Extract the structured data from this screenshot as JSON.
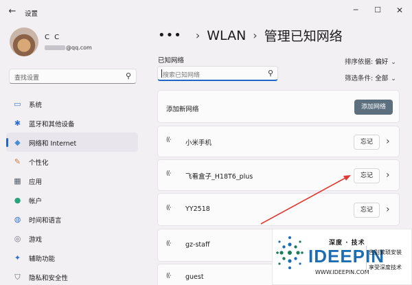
{
  "window": {
    "back_icon": "back-arrow-icon",
    "title": "设置",
    "controls": {
      "minimize": "─",
      "maximize": "☐",
      "close": "✕"
    }
  },
  "user": {
    "name": "C C",
    "email_suffix": "@qq.com"
  },
  "sidebar": {
    "search_placeholder": "查找设置",
    "items": [
      {
        "label": "系统",
        "icon": "monitor-icon",
        "color": "#3a78c9",
        "glyph": "▭"
      },
      {
        "label": "蓝牙和其他设备",
        "icon": "bluetooth-icon",
        "color": "#2f6fca",
        "glyph": "✱"
      },
      {
        "label": "网络和 Internet",
        "icon": "wifi-diamond-icon",
        "color": "#4a8bd6",
        "glyph": "◆",
        "active": true
      },
      {
        "label": "个性化",
        "icon": "brush-icon",
        "color": "#c07a3a",
        "glyph": "✎"
      },
      {
        "label": "应用",
        "icon": "apps-icon",
        "color": "#555d6b",
        "glyph": "▦"
      },
      {
        "label": "帐户",
        "icon": "person-icon",
        "color": "#2aa37a",
        "glyph": "●"
      },
      {
        "label": "时间和语言",
        "icon": "globe-clock-icon",
        "color": "#3578c8",
        "glyph": "◍"
      },
      {
        "label": "游戏",
        "icon": "gamepad-icon",
        "color": "#6b6f78",
        "glyph": "◎"
      },
      {
        "label": "辅助功能",
        "icon": "accessibility-icon",
        "color": "#2f6fca",
        "glyph": "✦"
      },
      {
        "label": "隐私和安全性",
        "icon": "shield-icon",
        "color": "#5a6470",
        "glyph": "⛉"
      }
    ]
  },
  "breadcrumb": {
    "more": "•••",
    "sep": "›",
    "parent": "WLAN",
    "current": "管理已知网络"
  },
  "known_networks": {
    "label": "已知网络",
    "search_placeholder": "搜索已知网络",
    "sort_label": "排序依据:",
    "sort_value": "偏好",
    "filter_label": "筛选条件:",
    "filter_value": "全部",
    "add_label": "添加新网络",
    "add_button": "添加网络",
    "forget_label": "忘记",
    "networks": [
      "小米手机",
      "飞看盒子_H18T6_plus",
      "YY2518",
      "gz-staff",
      "guest"
    ]
  },
  "colors": {
    "accent": "#2066c6",
    "add_button_bg": "#5b6f7f",
    "annotation_arrow": "#e23a32"
  },
  "watermark": {
    "brand_top": "深度 · 技术",
    "brand": "IDEEPIN",
    "url": "WWW.IDEEPIN.COM",
    "slogan1": "告别繁琐安装",
    "slogan2": "享受深度技术"
  }
}
